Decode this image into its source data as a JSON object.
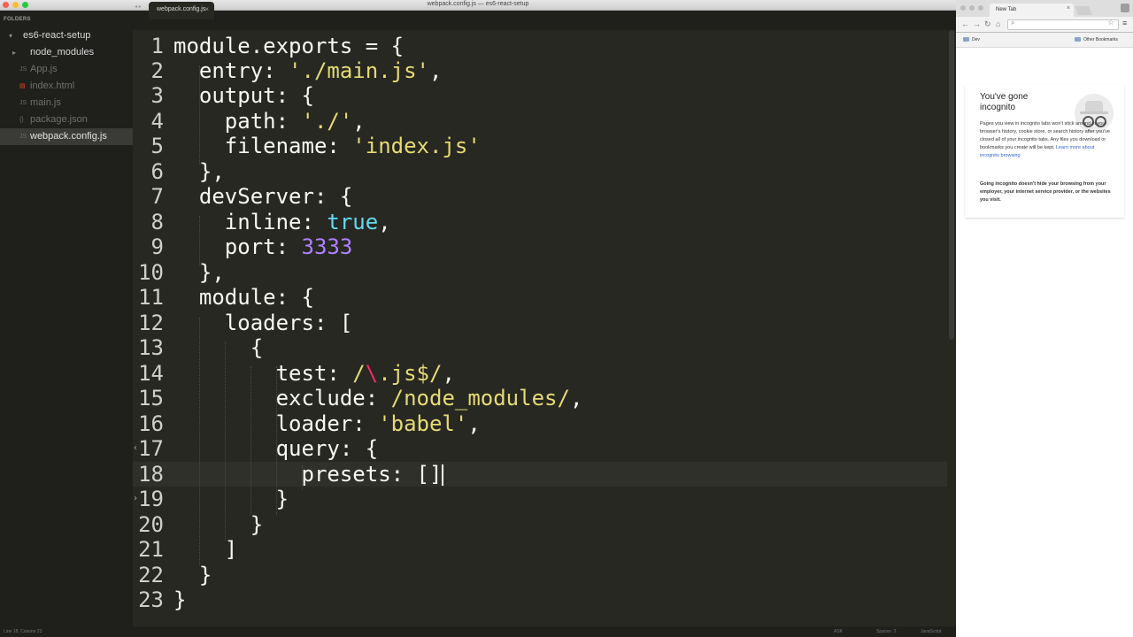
{
  "window": {
    "title": "webpack.config.js — es6-react-setup"
  },
  "sidebar": {
    "header": "FOLDERS",
    "project": "es6-react-setup",
    "items": [
      {
        "label": "node_modules",
        "type": "folder"
      },
      {
        "label": "App.js",
        "type": "file",
        "icon": "JS"
      },
      {
        "label": "index.html",
        "type": "file",
        "icon": "html-icon"
      },
      {
        "label": "main.js",
        "type": "file",
        "icon": "JS"
      },
      {
        "label": "package.json",
        "type": "file",
        "icon": "json-icon"
      },
      {
        "label": "webpack.config.js",
        "type": "file",
        "icon": "JS"
      }
    ]
  },
  "tabs": [
    {
      "label": "webpack.config.js",
      "close": "×"
    }
  ],
  "editor": {
    "lines": [
      {
        "n": "1"
      },
      {
        "n": "2"
      },
      {
        "n": "3"
      },
      {
        "n": "4"
      },
      {
        "n": "5"
      },
      {
        "n": "6"
      },
      {
        "n": "7"
      },
      {
        "n": "8"
      },
      {
        "n": "9"
      },
      {
        "n": "10"
      },
      {
        "n": "11"
      },
      {
        "n": "12"
      },
      {
        "n": "13"
      },
      {
        "n": "14"
      },
      {
        "n": "15"
      },
      {
        "n": "16"
      },
      {
        "n": "17"
      },
      {
        "n": "18"
      },
      {
        "n": "19"
      },
      {
        "n": "20"
      },
      {
        "n": "21"
      },
      {
        "n": "22"
      },
      {
        "n": "23"
      }
    ],
    "code": {
      "l1": "module.exports = {",
      "l2a": "  entry: ",
      "l2s": "'./main.js'",
      "l2c": ",",
      "l3": "  output: {",
      "l4a": "    path: ",
      "l4s": "'./'",
      "l4c": ",",
      "l5a": "    filename: ",
      "l5s": "'index.js'",
      "l6": "  },",
      "l7": "  devServer: {",
      "l8a": "    inline: ",
      "l8b": "true",
      "l8c": ",",
      "l9a": "    port: ",
      "l9n": "3333",
      "l10": "  },",
      "l11": "  module: {",
      "l12": "    loaders: [",
      "l13": "      {",
      "l14a": "        test: ",
      "l14s1": "/",
      "l14p": "\\",
      "l14s2": ".js$/",
      "l14c": ",",
      "l15a": "        exclude: ",
      "l15s": "/node_modules/",
      "l15c": ",",
      "l16a": "        loader: ",
      "l16s": "'babel'",
      "l16c": ",",
      "l17": "        query: {",
      "l18a": "          presets: ",
      "l18b": "[]",
      "l19": "        }",
      "l20": "      }",
      "l21": "    ]",
      "l22": "  }",
      "l23": "}"
    }
  },
  "statusbar": {
    "position": "Line 18, Column 23",
    "r1": "ASK",
    "r2": "Spaces: 2",
    "r3": "JavaScript"
  },
  "browser": {
    "tab_label": "New Tab",
    "tab_close": "×",
    "bookmarks": {
      "left": "Dev",
      "right": "Other Bookmarks"
    },
    "incognito": {
      "title": "You've gone incognito",
      "body": "Pages you view in incognito tabs won't stick around in your browser's history, cookie store, or search history after you've closed all of your incognito tabs. Any files you download or bookmarks you create will be kept.",
      "link": "Learn more about incognito browsing",
      "warning": "Going incognito doesn't hide your browsing from your employer, your internet service provider, or the websites you visit."
    }
  }
}
